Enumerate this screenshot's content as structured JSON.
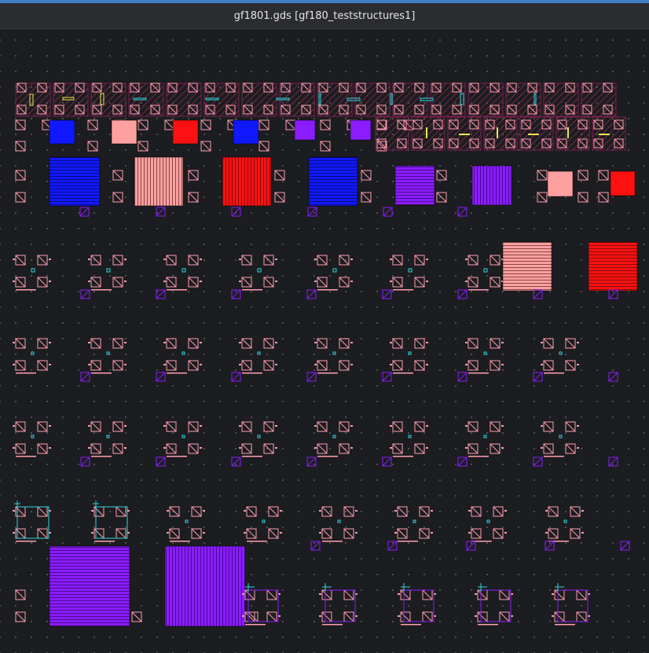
{
  "window": {
    "title": "gf1801.gds [gf180_teststructures1]"
  },
  "layout_view": {
    "grid": true,
    "background_color": "#1c1d20",
    "layer_colors": {
      "pad": "#ff9eb0",
      "blue": "#1018ff",
      "pink": "#ffa0a0",
      "red": "#ff1010",
      "violet": "#8a1cff",
      "cyan": "#2fd8e0",
      "yellow": "#e8e850",
      "maroon": "#5a1838"
    }
  }
}
